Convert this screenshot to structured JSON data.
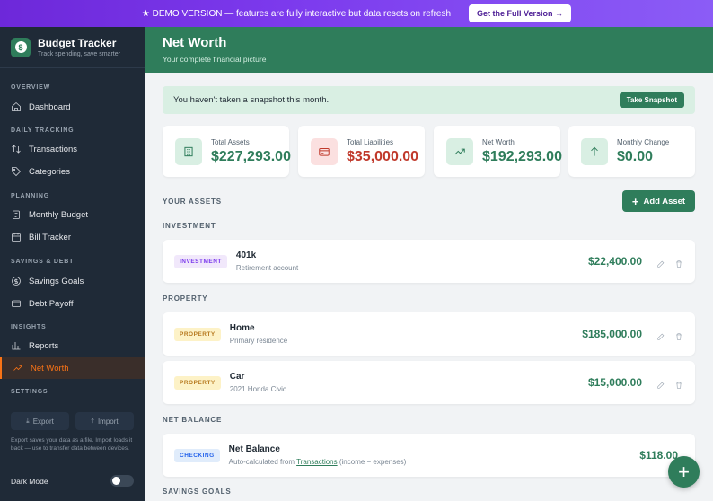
{
  "banner": {
    "text": "★ DEMO VERSION — features are fully interactive but data resets on refresh",
    "button": "Get the Full Version →"
  },
  "brand": {
    "title": "Budget Tracker",
    "subtitle": "Track spending, save smarter",
    "logo_glyph": "$"
  },
  "sidebar": {
    "sections": {
      "overview": "OVERVIEW",
      "daily": "DAILY TRACKING",
      "planning": "PLANNING",
      "savings": "SAVINGS & DEBT",
      "insights": "INSIGHTS",
      "settings": "SETTINGS"
    },
    "items": {
      "dashboard": "Dashboard",
      "transactions": "Transactions",
      "categories": "Categories",
      "budget": "Monthly Budget",
      "bills": "Bill Tracker",
      "goals": "Savings Goals",
      "debt": "Debt Payoff",
      "reports": "Reports",
      "networth": "Net Worth"
    },
    "export": "Export",
    "import": "Import",
    "note": "Export saves your data as a file. Import loads it back — use to transfer data between devices.",
    "dark_mode": "Dark Mode"
  },
  "header": {
    "title": "Net Worth",
    "subtitle": "Your complete financial picture"
  },
  "snapshot": {
    "message": "You haven't taken a snapshot this month.",
    "button": "Take Snapshot"
  },
  "stats": {
    "assets": {
      "label": "Total Assets",
      "value": "$227,293.00"
    },
    "liabilities": {
      "label": "Total Liabilities",
      "value": "$35,000.00"
    },
    "networth": {
      "label": "Net Worth",
      "value": "$192,293.00"
    },
    "change": {
      "label": "Monthly Change",
      "value": "$0.00"
    }
  },
  "colors": {
    "accent": "#2f7d5b",
    "danger": "#c0392b",
    "active_nav": "#f97316"
  },
  "assets": {
    "heading": "YOUR ASSETS",
    "add_button": "Add Asset",
    "investment_heading": "INVESTMENT",
    "property_heading": "PROPERTY",
    "net_balance_heading": "NET BALANCE",
    "savings_goals_heading": "SAVINGS GOALS",
    "k401": {
      "tag": "INVESTMENT",
      "name": "401k",
      "sub": "Retirement account",
      "amount": "$22,400.00"
    },
    "home": {
      "tag": "PROPERTY",
      "name": "Home",
      "sub": "Primary residence",
      "amount": "$185,000.00"
    },
    "car": {
      "tag": "PROPERTY",
      "name": "Car",
      "sub": "2021 Honda Civic",
      "amount": "$15,000.00"
    },
    "net": {
      "tag": "CHECKING",
      "name": "Net Balance",
      "sub_pre": "Auto-calculated from ",
      "sub_link": "Transactions",
      "sub_post": " (income − expenses)",
      "amount": "$118.00"
    }
  },
  "fab": "+"
}
